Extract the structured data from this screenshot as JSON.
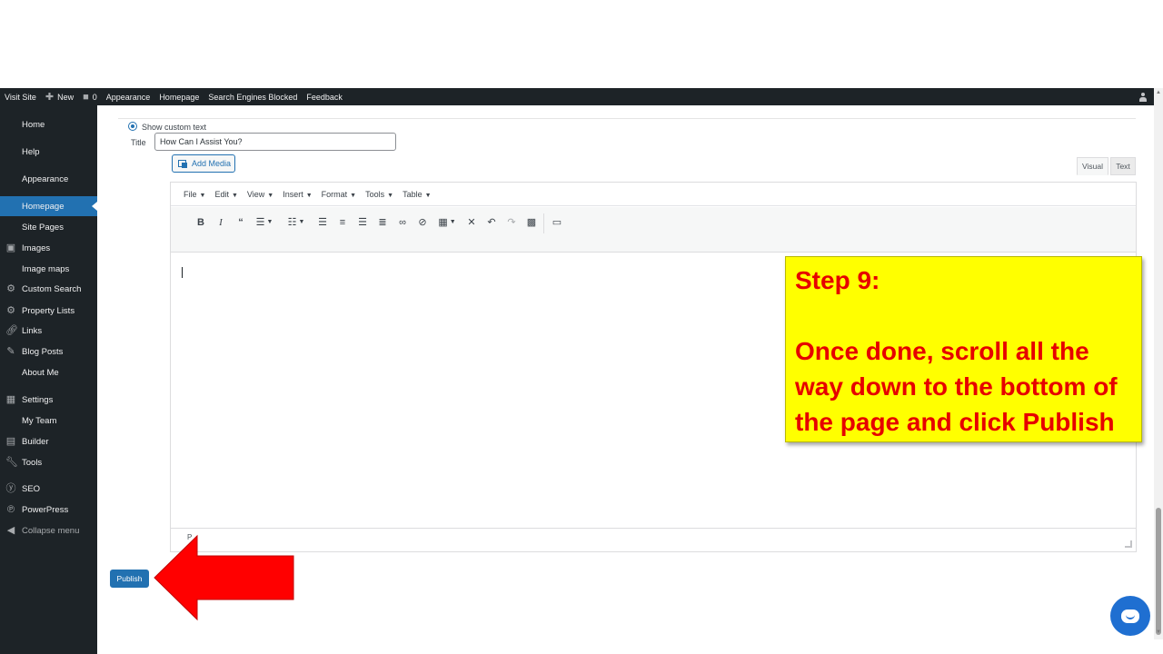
{
  "adminbar": {
    "items": [
      {
        "label": "Visit Site"
      },
      {
        "label": "New",
        "icon": "plus-icon"
      },
      {
        "label": "0",
        "icon": "comment-icon"
      },
      {
        "label": "Appearance"
      },
      {
        "label": "Homepage"
      },
      {
        "label": "Search Engines Blocked"
      },
      {
        "label": "Feedback"
      }
    ]
  },
  "sidebar": {
    "items": [
      {
        "label": "Home"
      },
      {
        "label": "Help"
      },
      {
        "label": "Appearance"
      },
      {
        "label": "Homepage",
        "active": true
      },
      {
        "label": "Site Pages"
      },
      {
        "label": "Images",
        "icon": "images-icon"
      },
      {
        "label": "Image maps"
      },
      {
        "label": "Custom Search",
        "icon": "gear-icon"
      },
      {
        "label": "Property Lists",
        "icon": "gear-icon"
      },
      {
        "label": "Links",
        "icon": "link-icon"
      },
      {
        "label": "Blog Posts",
        "icon": "pin-icon"
      },
      {
        "label": "About Me"
      },
      {
        "label": "Settings",
        "icon": "settings-icon"
      },
      {
        "label": "My Team"
      },
      {
        "label": "Builder",
        "icon": "grid-icon"
      },
      {
        "label": "Tools",
        "icon": "wrench-icon"
      },
      {
        "label": "SEO",
        "icon": "yoast-icon"
      },
      {
        "label": "PowerPress",
        "icon": "powerpress-icon"
      },
      {
        "label": "Collapse menu",
        "icon": "collapse-icon"
      }
    ]
  },
  "widget": {
    "radio_label": "Show custom text",
    "title_label": "Title",
    "title_value": "How Can I Assist You?",
    "add_media": "Add Media",
    "tab_visual": "Visual",
    "tab_text": "Text"
  },
  "editor": {
    "menus": [
      "File",
      "Edit",
      "View",
      "Insert",
      "Format",
      "Tools",
      "Table"
    ],
    "path": "P"
  },
  "publish": "Publish",
  "callout": {
    "step": "Step 9:",
    "body": "Once done, scroll all the way down to the bottom of the page and click Publish"
  },
  "colors": {
    "admin_dark": "#1d2327",
    "accent_blue": "#2271b1",
    "callout_yellow": "#ffff00",
    "callout_text_red": "#e60000",
    "arrow_red": "#ff0000"
  }
}
